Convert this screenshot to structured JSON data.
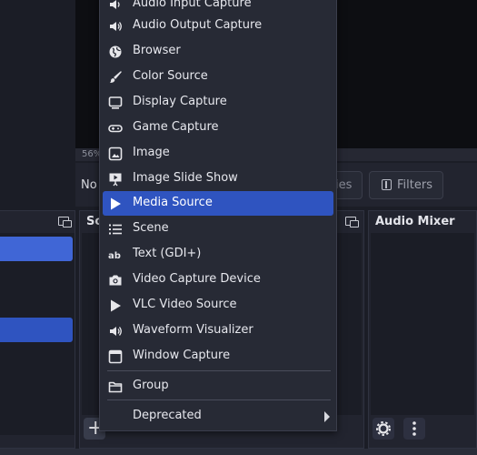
{
  "preview": {
    "zoom": "56%"
  },
  "context_bar": {
    "no_selection": "No",
    "properties_label": "ies",
    "filters_label": "Filters"
  },
  "docks": {
    "sources_title": "So",
    "mixer_title": "Audio Mixer"
  },
  "menu": {
    "items": [
      {
        "label": "Audio Input Capture",
        "icon": "speaker-icon"
      },
      {
        "label": "Audio Output Capture",
        "icon": "speaker-icon"
      },
      {
        "label": "Browser",
        "icon": "globe-icon"
      },
      {
        "label": "Color Source",
        "icon": "brush-icon"
      },
      {
        "label": "Display Capture",
        "icon": "monitor-icon"
      },
      {
        "label": "Game Capture",
        "icon": "gamepad-icon"
      },
      {
        "label": "Image",
        "icon": "image-icon"
      },
      {
        "label": "Image Slide Show",
        "icon": "slideshow-icon"
      },
      {
        "label": "Media Source",
        "icon": "play-icon"
      },
      {
        "label": "Scene",
        "icon": "list-icon"
      },
      {
        "label": "Text (GDI+)",
        "icon": "text-icon"
      },
      {
        "label": "Video Capture Device",
        "icon": "camera-icon"
      },
      {
        "label": "VLC Video Source",
        "icon": "play-icon"
      },
      {
        "label": "Waveform Visualizer",
        "icon": "speaker-icon"
      },
      {
        "label": "Window Capture",
        "icon": "window-icon"
      }
    ],
    "group_label": "Group",
    "deprecated_label": "Deprecated",
    "active_item": "Media Source"
  },
  "colors": {
    "accent": "#2f54c0",
    "scene_selected": "#3b5fd0"
  }
}
